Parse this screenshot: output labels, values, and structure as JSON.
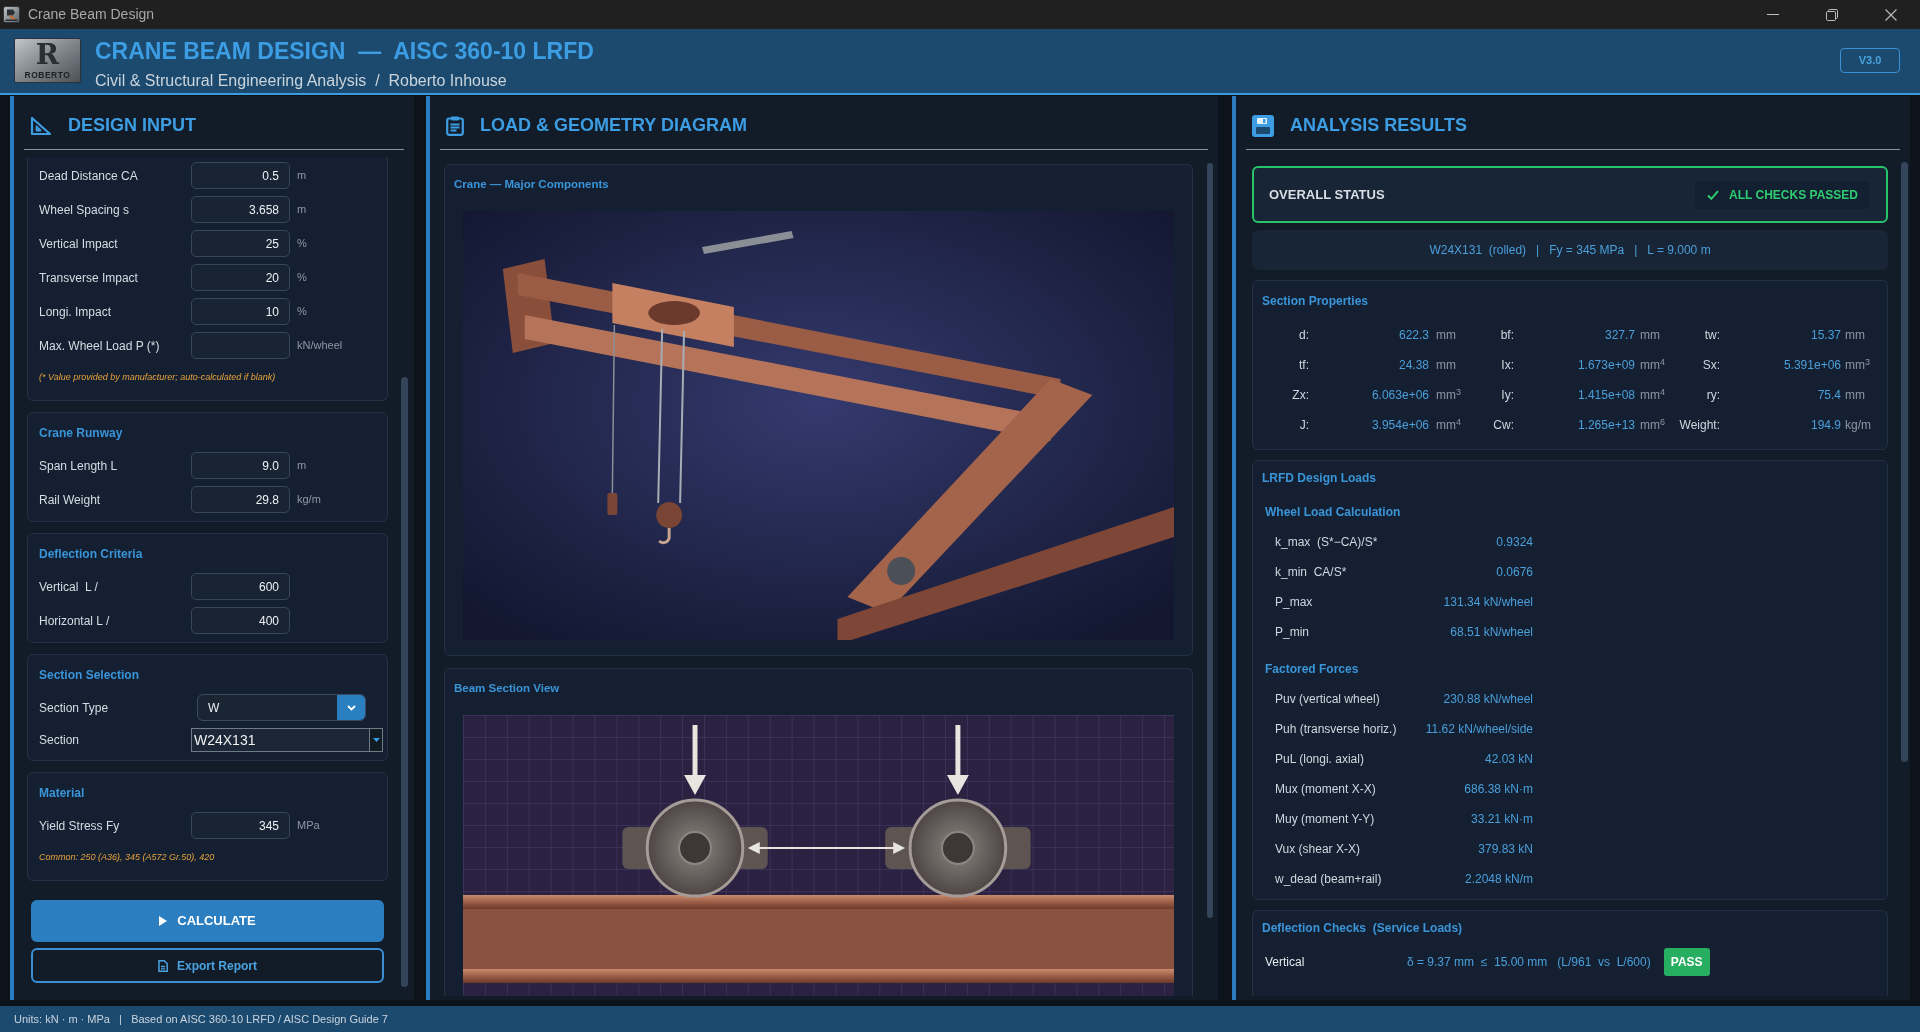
{
  "window": {
    "title": "Crane Beam Design"
  },
  "header": {
    "logo": {
      "mark": "R",
      "text": "ROBERTO"
    },
    "title": "CRANE BEAM DESIGN  —  AISC 360-10 LRFD",
    "subtitle": "Civil & Structural Engineering Analysis  /  Roberto Inhouse",
    "version": "V3.0"
  },
  "design_input": {
    "title": "DESIGN INPUT",
    "groups": [
      {
        "fields": [
          {
            "kind": "input",
            "label": "Dead Distance CA",
            "value": "0.5",
            "unit": "m"
          },
          {
            "kind": "input",
            "label": "Wheel Spacing s",
            "value": "3.658",
            "unit": "m"
          },
          {
            "kind": "input",
            "label": "Vertical Impact",
            "value": "25",
            "unit": "%"
          },
          {
            "kind": "input",
            "label": "Transverse Impact",
            "value": "20",
            "unit": "%"
          },
          {
            "kind": "input",
            "label": "Longi. Impact",
            "value": "10",
            "unit": "%"
          },
          {
            "kind": "input",
            "label": "Max. Wheel Load P (*)",
            "unit": "kN/wheel"
          }
        ],
        "note": "(* Value provided by manufacturer; auto-calculated if blank)"
      },
      {
        "title": "Crane Runway",
        "fields": [
          {
            "kind": "input",
            "label": "Span Length L",
            "value": "9.0",
            "unit": "m"
          },
          {
            "kind": "input",
            "label": "Rail Weight",
            "value": "29.8",
            "unit": "kg/m"
          }
        ]
      },
      {
        "title": "Deflection Criteria",
        "fields": [
          {
            "kind": "input",
            "label": "Vertical  L /",
            "value": "600"
          },
          {
            "kind": "input",
            "label": "Horizontal L /",
            "value": "400"
          }
        ]
      },
      {
        "title": "Section Selection",
        "fields": [
          {
            "kind": "dropdown",
            "label": "Section Type",
            "value": "W"
          },
          {
            "kind": "combo",
            "label": "Section",
            "value": "W24X131"
          }
        ]
      },
      {
        "title": "Material",
        "fields": [
          {
            "kind": "input",
            "label": "Yield Stress Fy",
            "value": "345",
            "unit": "MPa"
          }
        ],
        "note": "Common: 250 (A36), 345 (A572 Gr.50), 420"
      }
    ],
    "buttons": [
      {
        "kind": "primary",
        "label": "CALCULATE"
      },
      {
        "kind": "outline",
        "label": "Export Report"
      }
    ]
  },
  "diagram": {
    "title": "LOAD & GEOMETRY DIAGRAM",
    "cards": [
      {
        "kind": "crane",
        "title": "Crane — Major Components"
      },
      {
        "kind": "wheels",
        "title": "Beam Section View"
      }
    ]
  },
  "results": {
    "title": "ANALYSIS RESULTS",
    "overall_status": {
      "label": "OVERALL STATUS",
      "badge": "ALL CHECKS PASSED",
      "passed": true
    },
    "summary": "W24X131  (rolled)   |   Fy = 345 MPa   |   L = 9.000 m",
    "section_properties": {
      "title": "Section Properties",
      "items": [
        {
          "label": "d:",
          "value": "622.3",
          "unit": "mm"
        },
        {
          "label": "bf:",
          "value": "327.7",
          "unit": "mm"
        },
        {
          "label": "tw:",
          "value": "15.37",
          "unit": "mm"
        },
        {
          "label": "tf:",
          "value": "24.38",
          "unit": "mm"
        },
        {
          "label": "Ix:",
          "value": "1.673e+09",
          "unit": "mm$^{4}$"
        },
        {
          "label": "Sx:",
          "value": "5.391e+06",
          "unit": "mm$^{3}$"
        },
        {
          "label": "Zx:",
          "value": "6.063e+06",
          "unit": "mm$^{3}$"
        },
        {
          "label": "Iy:",
          "value": "1.415e+08",
          "unit": "mm$^{4}$"
        },
        {
          "label": "ry:",
          "value": "75.4",
          "unit": "mm"
        },
        {
          "label": "J:",
          "value": "3.954e+06",
          "unit": "mm$^{4}$"
        },
        {
          "label": "Cw:",
          "value": "1.265e+13",
          "unit": "mm$^{6}$"
        },
        {
          "label": "Weight:",
          "value": "194.9",
          "unit": "kg/m"
        }
      ]
    },
    "design_loads": {
      "title": "LRFD Design Loads",
      "sections": [
        {
          "title": "Wheel Load Calculation",
          "rows": [
            {
              "label": "k_max  (S*−CA)/S*",
              "value": "0.9324"
            },
            {
              "label": "k_min  CA/S*",
              "value": "0.0676"
            },
            {
              "label": "P_max",
              "value": "131.34 kN/wheel"
            },
            {
              "label": "P_min",
              "value": "68.51 kN/wheel"
            }
          ]
        },
        {
          "title": "Factored Forces",
          "rows": [
            {
              "label": "Puv (vertical wheel)",
              "value": "230.88 kN/wheel"
            },
            {
              "label": "Puh (transverse horiz.)",
              "value": "11.62 kN/wheel/side"
            },
            {
              "label": "PuL (longi. axial)",
              "value": "42.03 kN"
            },
            {
              "label": "Mux (moment X-X)",
              "value": "686.38 kN·m"
            },
            {
              "label": "Muy (moment Y-Y)",
              "value": "33.21 kN·m"
            },
            {
              "label": "Vux (shear X-X)",
              "value": "379.83 kN"
            },
            {
              "label": "w_dead (beam+rail)",
              "value": "2.2048 kN/m"
            }
          ]
        }
      ]
    },
    "deflection_checks": {
      "title": "Deflection Checks  (Service Loads)",
      "rows": [
        {
          "label": "Vertical",
          "result": "δ = 9.37 mm  ≤  15.00 mm   (L/961  vs  L/600)",
          "status": "PASS",
          "passed": true
        }
      ]
    }
  },
  "status_bar": {
    "text": "Units: kN · m · MPa   |   Based on AISC 360-10 LRFD / AISC Design Guide 7"
  }
}
